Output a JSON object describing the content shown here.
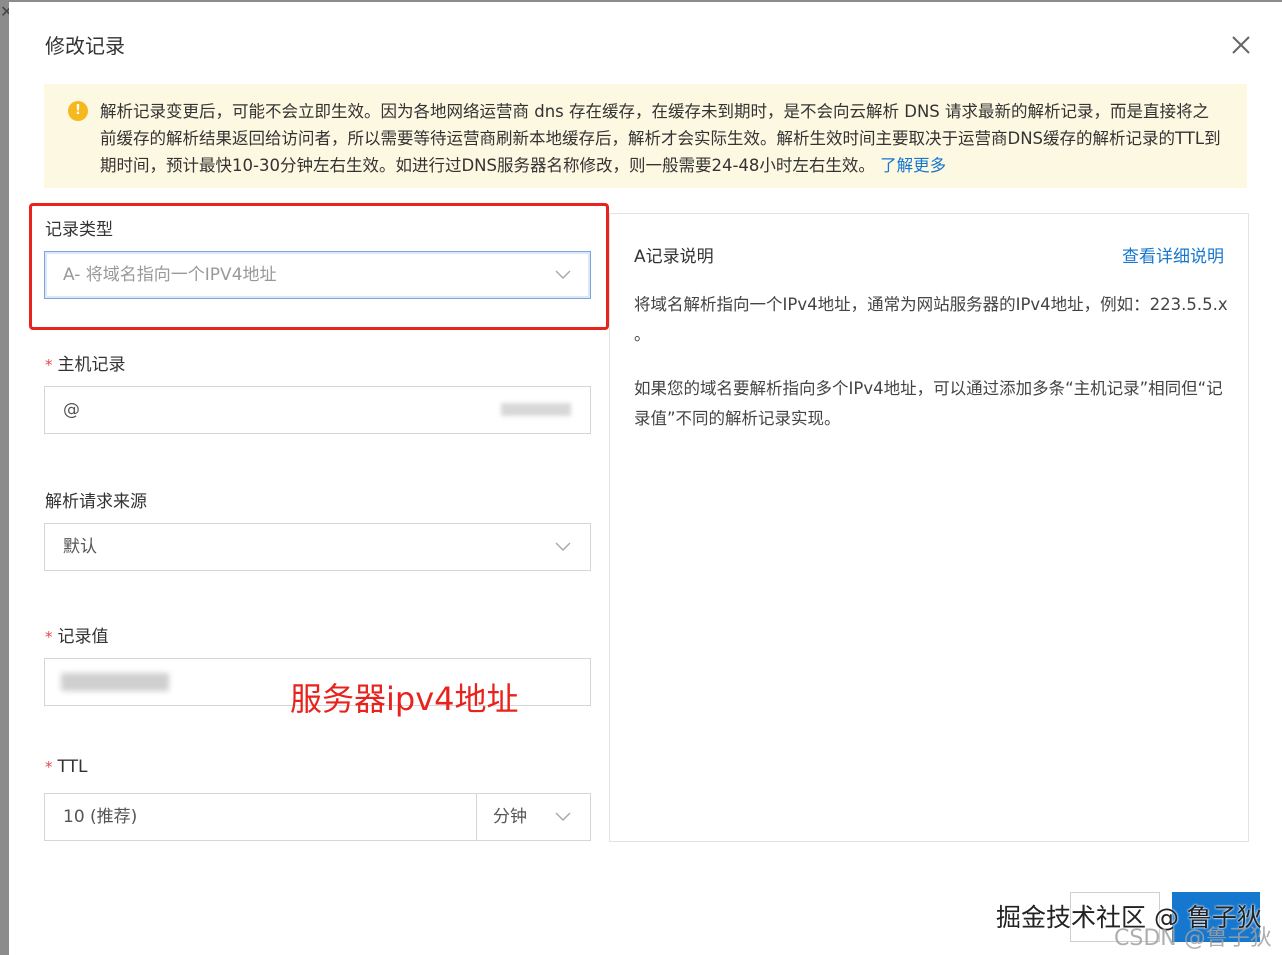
{
  "dialog": {
    "title": "修改记录"
  },
  "notice": {
    "text": "解析记录变更后，可能不会立即生效。因为各地网络运营商 dns 存在缓存，在缓存未到期时，是不会向云解析 DNS 请求最新的解析记录，而是直接将之前缓存的解析结果返回给访问者，所以需要等待运营商刷新本地缓存后，解析才会实际生效。解析生效时间主要取决于运营商DNS缓存的解析记录的TTL到期时间，预计最快10-30分钟左右生效。如进行过DNS服务器名称修改，则一般需要24-48小时左右生效。",
    "link": "了解更多",
    "icon": "warning-icon",
    "color": "#fdf8e1"
  },
  "form": {
    "record_type": {
      "label": "记录类型",
      "value": "A- 将域名指向一个IPV4地址"
    },
    "host": {
      "label": "主机记录",
      "value": "@"
    },
    "source": {
      "label": "解析请求来源",
      "value": "默认"
    },
    "record_value": {
      "label": "记录值"
    },
    "ttl": {
      "label": "TTL",
      "value": "10 (推荐)",
      "unit": "分钟"
    }
  },
  "annotation": {
    "text": "服务器ipv4地址",
    "color": "#e8231d"
  },
  "help": {
    "title": "A记录说明",
    "link": "查看详细说明",
    "p1": "将域名解析指向一个IPv4地址，通常为网站服务器的IPv4地址，例如：223.5.5.x 。",
    "p2": "如果您的域名要解析指向多个IPv4地址，可以通过添加多条“主机记录”相同但“记录值”不同的解析记录实现。"
  },
  "watermarks": {
    "primary": "掘金技术社区 @ 鲁子狄",
    "secondary": "CSDN @鲁子狄"
  },
  "colors": {
    "link": "#1677cf",
    "primary_button": "#1677cf"
  }
}
